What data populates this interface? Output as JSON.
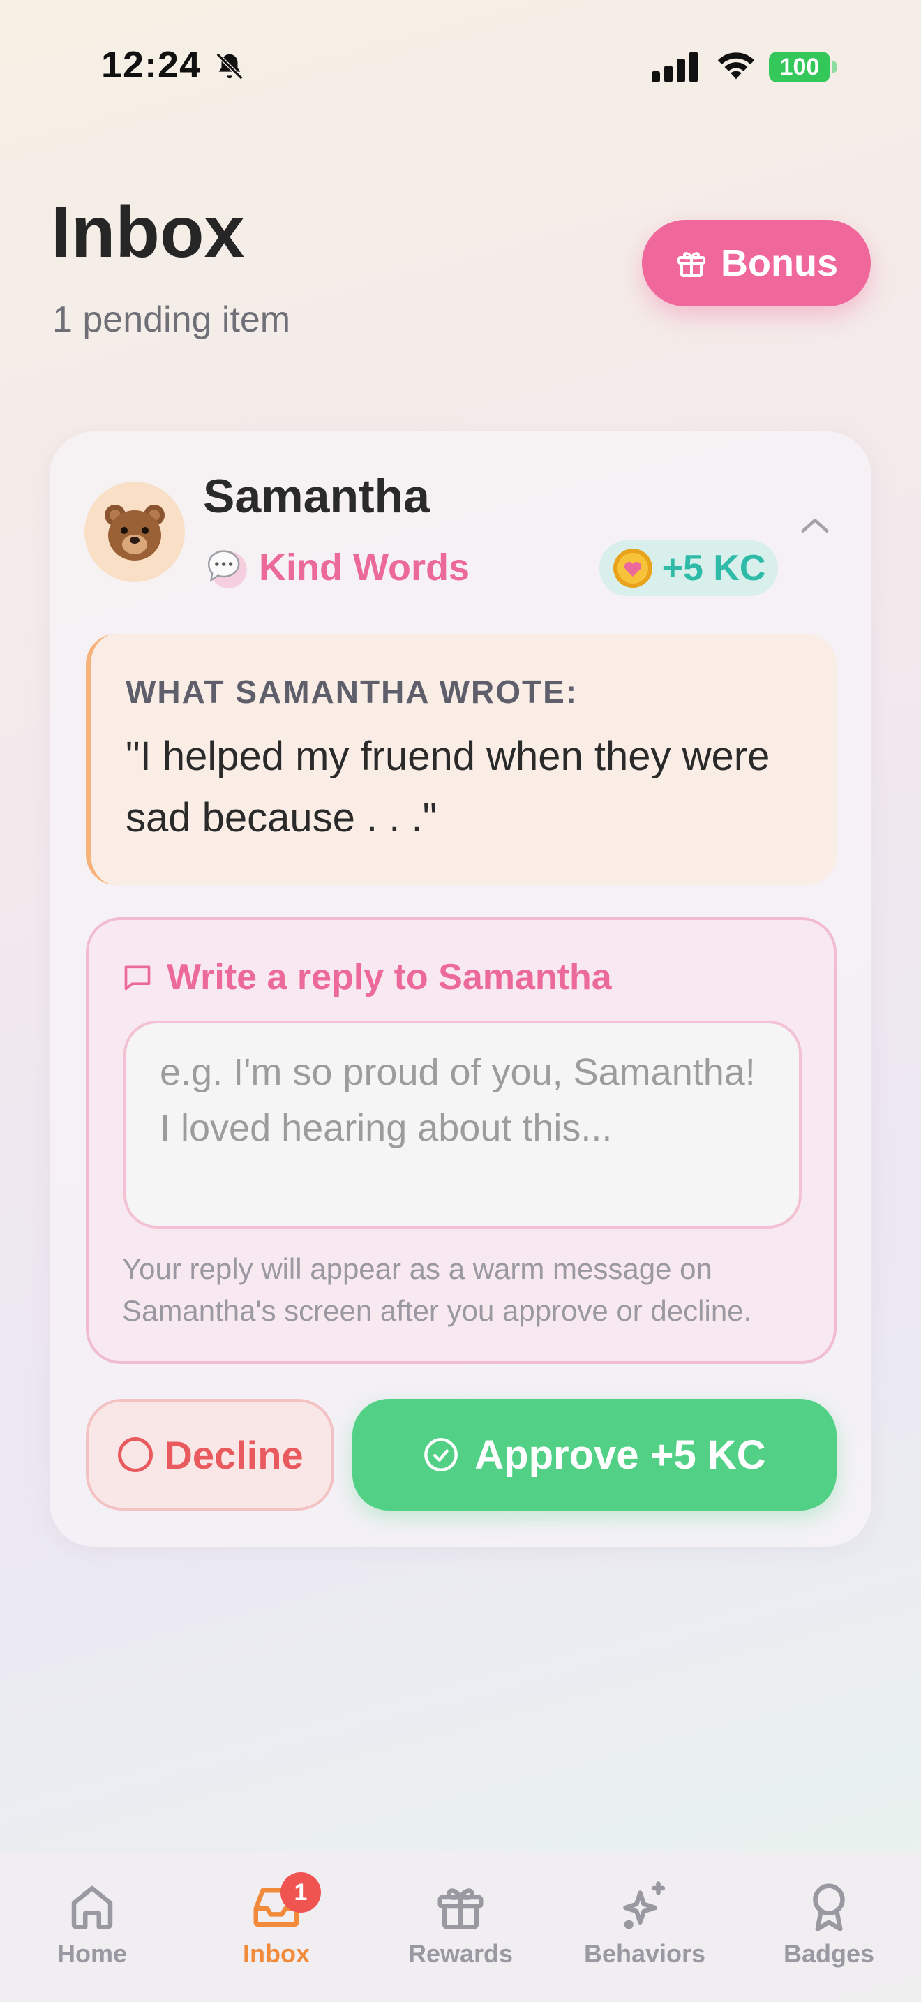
{
  "status_bar": {
    "time": "12:24",
    "battery": "100"
  },
  "header": {
    "title": "Inbox",
    "subtitle": "1 pending item",
    "bonus_label": "Bonus"
  },
  "card": {
    "child_name": "Samantha",
    "behavior": "Kind Words",
    "reward": "+5 KC",
    "quote_label": "WHAT SAMANTHA WROTE:",
    "quote_text": "\"I helped my fruend when they were sad because . . .\"",
    "reply": {
      "title": "Write a reply to Samantha",
      "placeholder": "e.g. I'm so proud of you, Samantha! I loved hearing about this...",
      "note": "Your reply will appear as a warm message on Samantha's screen after you approve or decline."
    },
    "decline_label": "Decline",
    "approve_label": "Approve +5 KC"
  },
  "tabs": [
    {
      "label": "Home",
      "icon": "home-icon",
      "active": false
    },
    {
      "label": "Inbox",
      "icon": "inbox-icon",
      "active": true,
      "badge": "1"
    },
    {
      "label": "Rewards",
      "icon": "gift-icon",
      "active": false
    },
    {
      "label": "Behaviors",
      "icon": "sparkle-icon",
      "active": false
    },
    {
      "label": "Badges",
      "icon": "award-icon",
      "active": false
    }
  ],
  "colors": {
    "accent_pink": "#f0689b",
    "approve_green": "#52d186",
    "decline_red": "#e85a5d",
    "active_tab": "#f28a3b",
    "kc_teal": "#2fbba8"
  }
}
